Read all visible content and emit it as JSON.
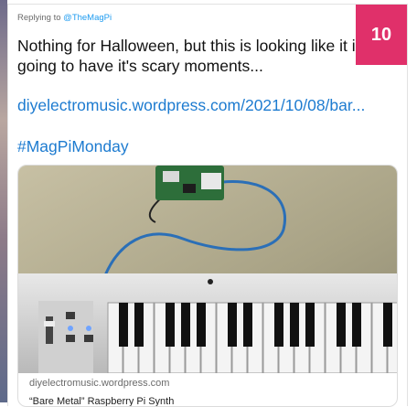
{
  "badge": {
    "number": "10"
  },
  "tweet": {
    "replying_prefix": "Replying to",
    "replying_handle": "@TheMagPi",
    "text": "Nothing for Halloween, but this is looking like it is going to have it's scary moments...",
    "link": "diyelectromusic.wordpress.com/2021/10/08/bar...",
    "hashtag": "#MagPiMonday"
  },
  "media": {
    "domain": "diyelectromusic.wordpress.com",
    "title": "“Bare Metal” Raspberry Pi Synth"
  },
  "colors": {
    "badge": "#e0306a",
    "link": "#1d7bd0",
    "handle": "#1d9bf0"
  }
}
